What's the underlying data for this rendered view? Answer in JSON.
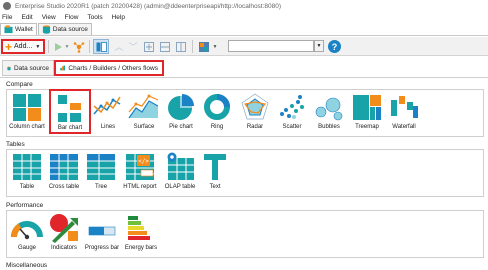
{
  "window": {
    "title": "Enterprise Studio 2020R1 (patch 20200428) (admin@ddeenterpriseapi/http://localhost:8080)"
  },
  "menu": [
    "File",
    "Edit",
    "View",
    "Flow",
    "Tools",
    "Help"
  ],
  "doc_tabs": [
    {
      "label": "Wallet",
      "icon": "wallet-icon"
    },
    {
      "label": "Data source",
      "icon": "database-icon"
    }
  ],
  "toolbar": {
    "add_label": "Add...",
    "search_value": "",
    "help_label": "?"
  },
  "sub_tabs": [
    {
      "label": "Data source"
    },
    {
      "label": "Charts / Builders / Others flows"
    }
  ],
  "groups": {
    "compare": {
      "title": "Compare",
      "items": [
        "Column chart",
        "Bar chart",
        "Lines",
        "Surface",
        "Pie chart",
        "Ring",
        "Radar",
        "Scatter",
        "Bubbles",
        "Treemap",
        "Waterfall"
      ]
    },
    "tables": {
      "title": "Tables",
      "items": [
        "Table",
        "Cross table",
        "Tree",
        "HTML report",
        "OLAP table",
        "Text"
      ]
    },
    "performance": {
      "title": "Performance",
      "items": [
        "Gauge",
        "Indicators",
        "Progress bar",
        "Energy bars"
      ]
    },
    "misc": {
      "title": "Miscellaneous"
    }
  },
  "colors": {
    "teal": "#18a3a8",
    "orange": "#f28c1a",
    "blue": "#1b82c5",
    "highlight": "#e0252b"
  }
}
